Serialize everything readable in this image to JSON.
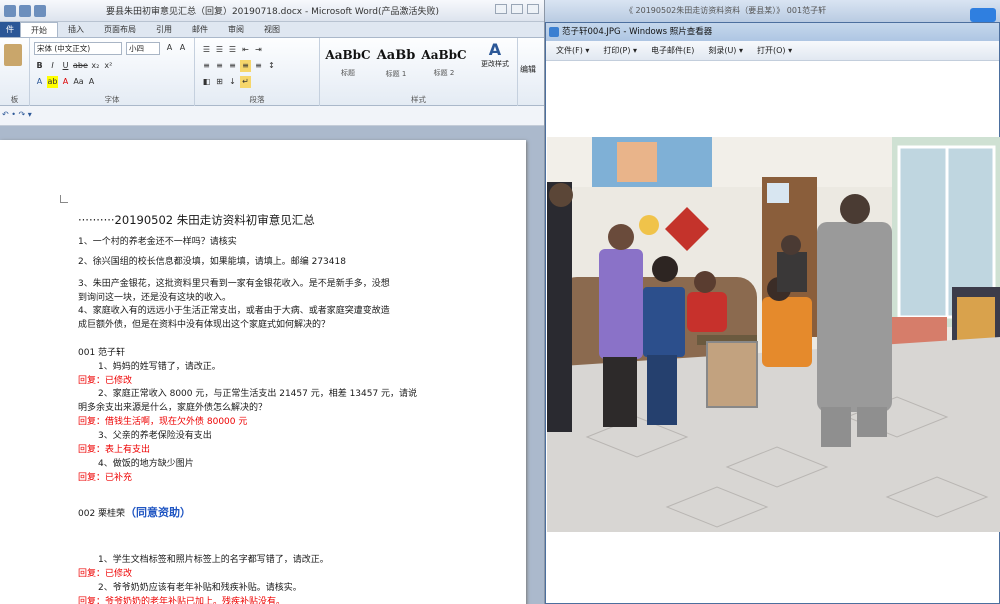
{
  "word": {
    "title": "要县朱田初审意见汇总（回复）20190718.docx - Microsoft Word(产品激活失败)",
    "tabs": [
      "件",
      "开始",
      "插入",
      "页面布局",
      "引用",
      "邮件",
      "审阅",
      "视图"
    ],
    "font_name": "宋体 (中文正文)",
    "font_size": "小四",
    "format_buttons": [
      "B",
      "I",
      "U",
      "abe",
      "x₂",
      "x²"
    ],
    "styles": [
      {
        "sample": "AaBbC",
        "label": "标题"
      },
      {
        "sample": "AaBb",
        "label": "标题 1"
      },
      {
        "sample": "AaBbC",
        "label": "标题 2"
      }
    ],
    "change_styles": "更改样式",
    "edit": "编辑",
    "groups": {
      "clipboard": "板",
      "font": "字体",
      "paragraph": "段落",
      "styles": "样式"
    },
    "doc": {
      "heading": "··········20190502 朱田走访资料初审意见汇总",
      "items": [
        "1、一个村的养老金还不一样吗？请核实",
        "2、徐兴国组的校长信息都没填，如果能填，请填上。邮编 273418",
        "3、朱田产金银花，这批资料里只看到一家有金银花收入。是不是新手多，没想",
        "到询问这一块，还是没有这块的收入。",
        "4、家庭收入有的远远小于生活正常支出，或者由于大病、或者家庭突遭变故造",
        "成巨额外债，但是在资料中没有体现出这个家庭式如何解决的？"
      ],
      "case1_label": "001 范子轩",
      "case1": [
        {
          "text": "1、妈妈的姓写错了，请改正。",
          "reply": "回复：已修改"
        },
        {
          "text": "2、家庭正常收入 8000 元，与正常生活支出 21457 元，相差 13457 元，请说",
          "text2": "明多余支出来源是什么，家庭外债怎么解决的？",
          "reply": "回复：借钱生活啊，现在欠外债 80000 元"
        },
        {
          "text": "3、父亲的养老保险没有支出",
          "reply": "回复：表上有支出"
        },
        {
          "text": "4、做饭的地方缺少图片",
          "reply": "回复：已补充"
        }
      ],
      "case2_label": "002 栗桂荣",
      "case2_tag": "（同意资助）",
      "case2": [
        {
          "text": "1、学生文档标签和照片标签上的名字都写错了，请改正。",
          "reply": "回复：已修改"
        },
        {
          "text": "2、爷爷奶奶应该有老年补贴和残疾补贴。请核实。",
          "reply": "回复：爷爷奶奶的老年补贴已加上。残疾补贴没有。"
        }
      ]
    }
  },
  "viewer": {
    "top_strip": "《 20190502朱田走访资料资料（要县某）》 001范子轩",
    "title": "范子轩004.JPG - Windows 照片查看器",
    "menu": [
      "文件(F) ▾",
      "打印(P) ▾",
      "电子邮件(E)",
      "刻录(U) ▾",
      "打开(O) ▾"
    ]
  },
  "colors": {
    "reply": "#ee0000",
    "accent": "#2b5797",
    "tag": "#1f55c2"
  }
}
